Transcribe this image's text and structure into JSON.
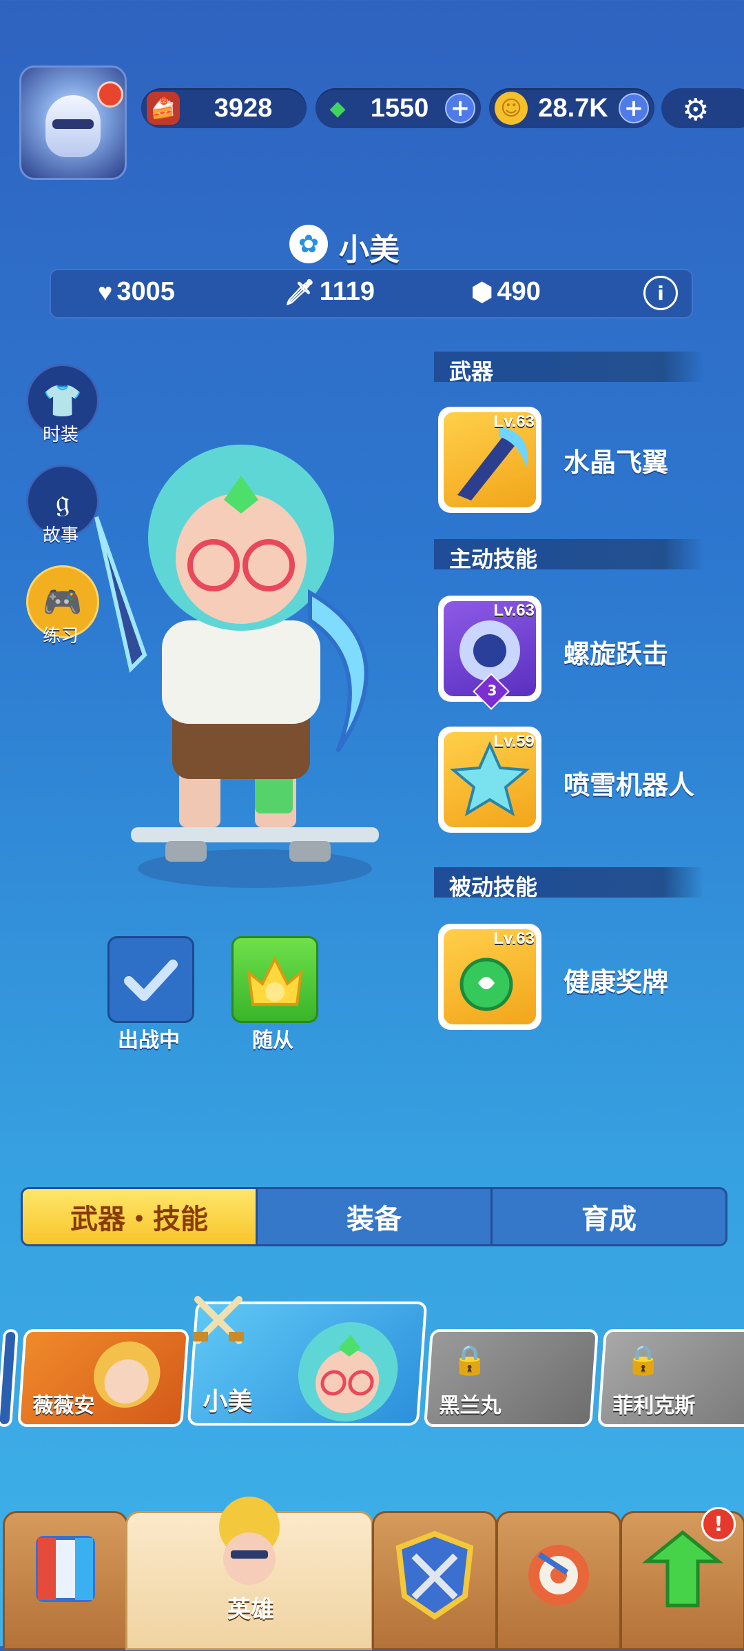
{
  "top_bar": {
    "resources": [
      {
        "icon": "cake-icon",
        "value": "3928",
        "has_plus": false
      },
      {
        "icon": "gem-icon",
        "value": "1550",
        "has_plus": true
      },
      {
        "icon": "coin-icon",
        "value": "28.7K",
        "has_plus": true
      }
    ],
    "settings_icon": "gear-icon"
  },
  "hero": {
    "name": "小美",
    "stats": {
      "health": "3005",
      "attack": "1119",
      "defense": "490"
    }
  },
  "side_buttons": [
    {
      "icon": "shirt-icon",
      "label": "时装"
    },
    {
      "icon": "story-icon",
      "label": "故事"
    },
    {
      "icon": "gamepad-icon",
      "label": "练习"
    }
  ],
  "sections": {
    "weapon": {
      "header": "武器",
      "items": [
        {
          "level": "Lv.63",
          "name": "水晶飞翼"
        }
      ]
    },
    "active": {
      "header": "主动技能",
      "items": [
        {
          "level": "Lv.63",
          "name": "螺旋跃击",
          "badge": "3"
        },
        {
          "level": "Lv.59",
          "name": "喷雪机器人"
        }
      ]
    },
    "passive": {
      "header": "被动技能",
      "items": [
        {
          "level": "Lv.63",
          "name": "健康奖牌"
        }
      ]
    }
  },
  "actions": {
    "deployed": "出战中",
    "follower": "随从"
  },
  "tabs": [
    "武器・技能",
    "装备",
    "育成"
  ],
  "heroes": [
    {
      "name": "薇薇安",
      "locked": false
    },
    {
      "name": "小美",
      "locked": false,
      "selected": true
    },
    {
      "name": "黑兰丸",
      "locked": true
    },
    {
      "name": "菲利克斯",
      "locked": true
    }
  ],
  "nav": {
    "hero_label": "英雄",
    "alert_badge": "!"
  },
  "colors": {
    "accent_yellow": "#f7c52a",
    "bg_blue": "#2d78d0",
    "alert_red": "#e53a2b"
  }
}
